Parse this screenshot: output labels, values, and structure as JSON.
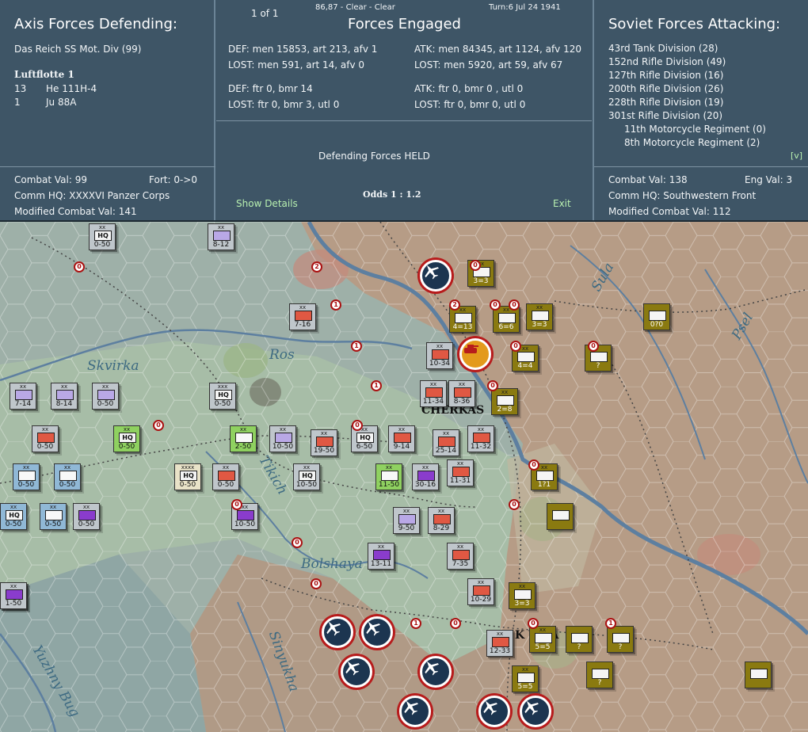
{
  "header": {
    "page": "1 of 1",
    "coords_weather": "86,87 - Clear - Clear",
    "turn": "Turn:6  Jul 24 1941"
  },
  "axis": {
    "title": "Axis Forces Defending:",
    "unit": "Das Reich SS Mot. Div (99)",
    "air_group": "Luftflotte 1",
    "air": [
      {
        "count": "13",
        "type": "He 111H-4"
      },
      {
        "count": "1",
        "type": "Ju 88A"
      }
    ],
    "combat_val": "Combat Val: 99",
    "fort": "Fort: 0->0",
    "comm_hq": "Comm HQ: XXXXVI Panzer Corps",
    "modified": "Modified Combat Val: 141"
  },
  "engaged": {
    "title": "Forces Engaged",
    "def_ground": "DEF: men 15853, art 213, afv 1",
    "def_ground_lost": "LOST: men 591, art 14, afv 0",
    "atk_ground": "ATK: men 84345, art 1124, afv 120",
    "atk_ground_lost": "LOST: men 5920, art 59, afv 67",
    "def_air": "DEF: ftr 0, bmr 14",
    "def_air_lost": "LOST: ftr 0, bmr 3, utl 0",
    "atk_air": "ATK: ftr 0, bmr 0 , utl 0",
    "atk_air_lost": "LOST: ftr 0, bmr 0, utl 0",
    "result": "Defending Forces HELD",
    "odds": "Odds 1 : 1.2",
    "show_details": "Show Details",
    "exit": "Exit"
  },
  "soviet": {
    "title": "Soviet Forces Attacking:",
    "units": [
      "43rd Tank Division (28)",
      "152nd Rifle Division (49)",
      "127th Rifle Division (16)",
      "200th Rifle Division (26)",
      "228th Rifle Division (19)",
      "301st Rifle Division (20)"
    ],
    "sub_units": [
      "11th Motorcycle Regiment (0)",
      "8th Motorcycle Regiment (2)"
    ],
    "more": "[v]",
    "combat_val": "Combat Val: 138",
    "eng_val": "Eng Val: 3",
    "comm_hq": "Comm HQ: Southwestern Front",
    "modified": "Modified Combat Val: 112"
  },
  "map": {
    "labels": {
      "skvirka": "Skvirka",
      "ros": "Ros",
      "tikich": "Tikich",
      "bolshaya": "Bolshaya",
      "sinyukha": "Sinyukha",
      "yuzhny_bug": "Yuzhny Bug",
      "sula": "Sula",
      "psel": "Psel",
      "cherkasy": "CHERKAS",
      "kirovograd": "K  V  RA"
    },
    "units": [
      {
        "v": "0-50",
        "sz": "xx",
        "c": "grey",
        "s": "s-hq",
        "t": "HQ"
      },
      {
        "v": "8-12",
        "sz": "xx",
        "c": "grey",
        "s": "s-lav"
      },
      {
        "v": "7-16",
        "sz": "xx",
        "c": "grey",
        "s": "s-red"
      },
      {
        "v": "7-14",
        "sz": "xx",
        "c": "grey",
        "s": "s-lav"
      },
      {
        "v": "8-14",
        "sz": "xx",
        "c": "grey",
        "s": "s-lav"
      },
      {
        "v": "0-50",
        "sz": "xx",
        "c": "grey",
        "s": "s-lav"
      },
      {
        "v": "0-50",
        "sz": "xxx",
        "c": "grey",
        "s": "s-hq",
        "t": "HQ"
      },
      {
        "v": "0-50",
        "sz": "xx",
        "c": "grey",
        "s": "s-red"
      },
      {
        "v": "0-50",
        "sz": "xx",
        "c": "green",
        "s": "s-hq",
        "t": "HQ"
      },
      {
        "v": "2-50",
        "sz": "xx",
        "c": "green",
        "s": "s-white"
      },
      {
        "v": "10-50",
        "sz": "xx",
        "c": "grey",
        "s": "s-lav"
      },
      {
        "v": "19-50",
        "sz": "xx",
        "c": "grey",
        "s": "s-red"
      },
      {
        "v": "6-50",
        "sz": "xx",
        "c": "grey",
        "s": "s-hq",
        "t": "HQ"
      },
      {
        "v": "9-14",
        "sz": "xx",
        "c": "grey",
        "s": "s-red"
      },
      {
        "v": "25-14",
        "sz": "xx",
        "c": "grey",
        "s": "s-red"
      },
      {
        "v": "11-32",
        "sz": "xx",
        "c": "grey",
        "s": "s-red"
      },
      {
        "v": "0-50",
        "sz": "xx",
        "c": "blue",
        "s": "s-white"
      },
      {
        "v": "0-50",
        "sz": "xx",
        "c": "blue",
        "s": "s-white"
      },
      {
        "v": "0-50",
        "sz": "xxxx",
        "c": "cream",
        "s": "s-hq",
        "t": "HQ"
      },
      {
        "v": "0-50",
        "sz": "xx",
        "c": "grey",
        "s": "s-red"
      },
      {
        "v": "10-50",
        "sz": "xx",
        "c": "grey",
        "s": "s-hq",
        "t": "HQ"
      },
      {
        "v": "11-50",
        "sz": "xx",
        "c": "green",
        "s": "s-white"
      },
      {
        "v": "30-16",
        "sz": "xx",
        "c": "grey",
        "s": "s-purple"
      },
      {
        "v": "11-31",
        "sz": "xx",
        "c": "grey",
        "s": "s-red"
      },
      {
        "v": "0-50",
        "sz": "xx",
        "c": "blue",
        "s": "s-hq",
        "t": "HQ"
      },
      {
        "v": "0-50",
        "sz": "xx",
        "c": "blue",
        "s": "s-white"
      },
      {
        "v": "0-50",
        "sz": "xx",
        "c": "grey",
        "s": "s-purple"
      },
      {
        "v": "10-50",
        "sz": "xx",
        "c": "grey",
        "s": "s-purple"
      },
      {
        "v": "9-50",
        "sz": "xx",
        "c": "grey",
        "s": "s-lav"
      },
      {
        "v": "8-29",
        "sz": "xx",
        "c": "grey",
        "s": "s-red"
      },
      {
        "v": "13-11",
        "sz": "xx",
        "c": "grey",
        "s": "s-purple"
      },
      {
        "v": "7-35",
        "sz": "xx",
        "c": "grey",
        "s": "s-red"
      },
      {
        "v": "11-50",
        "sz": "xx",
        "c": "grey",
        "s": "s-purple"
      },
      {
        "v": "10-29",
        "sz": "xx",
        "c": "grey",
        "s": "s-red"
      },
      {
        "v": "12-33",
        "sz": "xx",
        "c": "grey",
        "s": "s-red"
      },
      {
        "v": "10-34",
        "sz": "xx",
        "c": "grey",
        "s": "s-red"
      },
      {
        "v": "11-34",
        "sz": "xx",
        "c": "grey",
        "s": "s-red"
      },
      {
        "v": "8-36",
        "sz": "xx",
        "c": "grey",
        "s": "s-red"
      },
      {
        "v": "3=3",
        "sz": "xx",
        "c": "olive",
        "s": "s-white"
      },
      {
        "v": "4=13",
        "sz": "xx",
        "c": "olive",
        "s": "s-white"
      },
      {
        "v": "6=6",
        "sz": "xx",
        "c": "olive",
        "s": "s-white"
      },
      {
        "v": "3=3",
        "sz": "xx",
        "c": "olive",
        "s": "s-white"
      },
      {
        "v": "4=4",
        "sz": "xx",
        "c": "olive",
        "s": "s-white"
      },
      {
        "v": "2=8",
        "sz": "xx",
        "c": "olive",
        "s": "s-white"
      },
      {
        "v": "?",
        "sz": "",
        "c": "olive",
        "s": "s-white"
      },
      {
        "v": "0?0",
        "sz": "",
        "c": "olive",
        "s": "s-white"
      },
      {
        "v": "1?1",
        "sz": "xx",
        "c": "olive",
        "s": "s-white"
      },
      {
        "v": "",
        "sz": "",
        "c": "olive",
        "s": "s-white"
      },
      {
        "v": "3=3",
        "sz": "xx",
        "c": "olive",
        "s": "s-white"
      },
      {
        "v": "5=5",
        "sz": "xx",
        "c": "olive",
        "s": "s-white"
      },
      {
        "v": "?",
        "sz": "",
        "c": "olive",
        "s": "s-white"
      },
      {
        "v": "?",
        "sz": "",
        "c": "olive",
        "s": "s-white"
      },
      {
        "v": "?",
        "sz": "",
        "c": "olive",
        "s": "s-white"
      },
      {
        "v": "5=5",
        "sz": "xx",
        "c": "olive",
        "s": "s-white"
      },
      {
        "v": "",
        "sz": "",
        "c": "olive",
        "s": "s-white"
      },
      {
        "v": "1-50",
        "sz": "xx",
        "c": "grey",
        "s": "s-purple"
      }
    ],
    "markers": [
      "0",
      "2",
      "1",
      "1",
      "1",
      "0",
      "0",
      "0",
      "0",
      "0",
      "0",
      "0",
      "0",
      "0",
      "0",
      "2",
      "0",
      "0",
      "0",
      "1",
      "0",
      "0",
      "1"
    ]
  }
}
